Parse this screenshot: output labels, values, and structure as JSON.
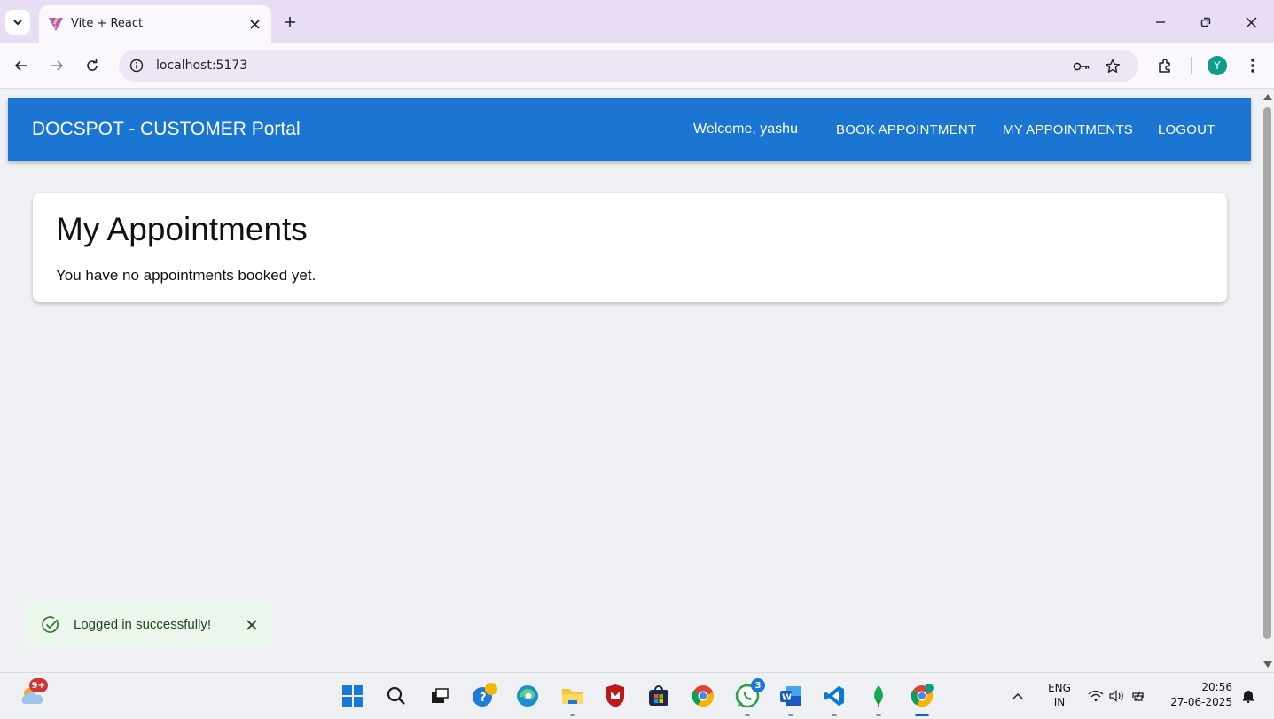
{
  "browser": {
    "tab_title": "Vite + React",
    "url": "localhost:5173",
    "profile_initial": "Y"
  },
  "app": {
    "brand": "DOCSPOT - CUSTOMER Portal",
    "welcome": "Welcome, yashu",
    "nav": {
      "book": "BOOK APPOINTMENT",
      "mine": "MY APPOINTMENTS",
      "logout": "LOGOUT"
    },
    "accent_color": "#1a76d2"
  },
  "main": {
    "heading": "My Appointments",
    "empty_message": "You have no appointments booked yet."
  },
  "toast": {
    "message": "Logged in successfully!"
  },
  "taskbar": {
    "weather_badge": "9+",
    "whatsapp_badge": "3",
    "lang_top": "ENG",
    "lang_bottom": "IN",
    "time": "20:56",
    "date": "27-06-2025"
  }
}
